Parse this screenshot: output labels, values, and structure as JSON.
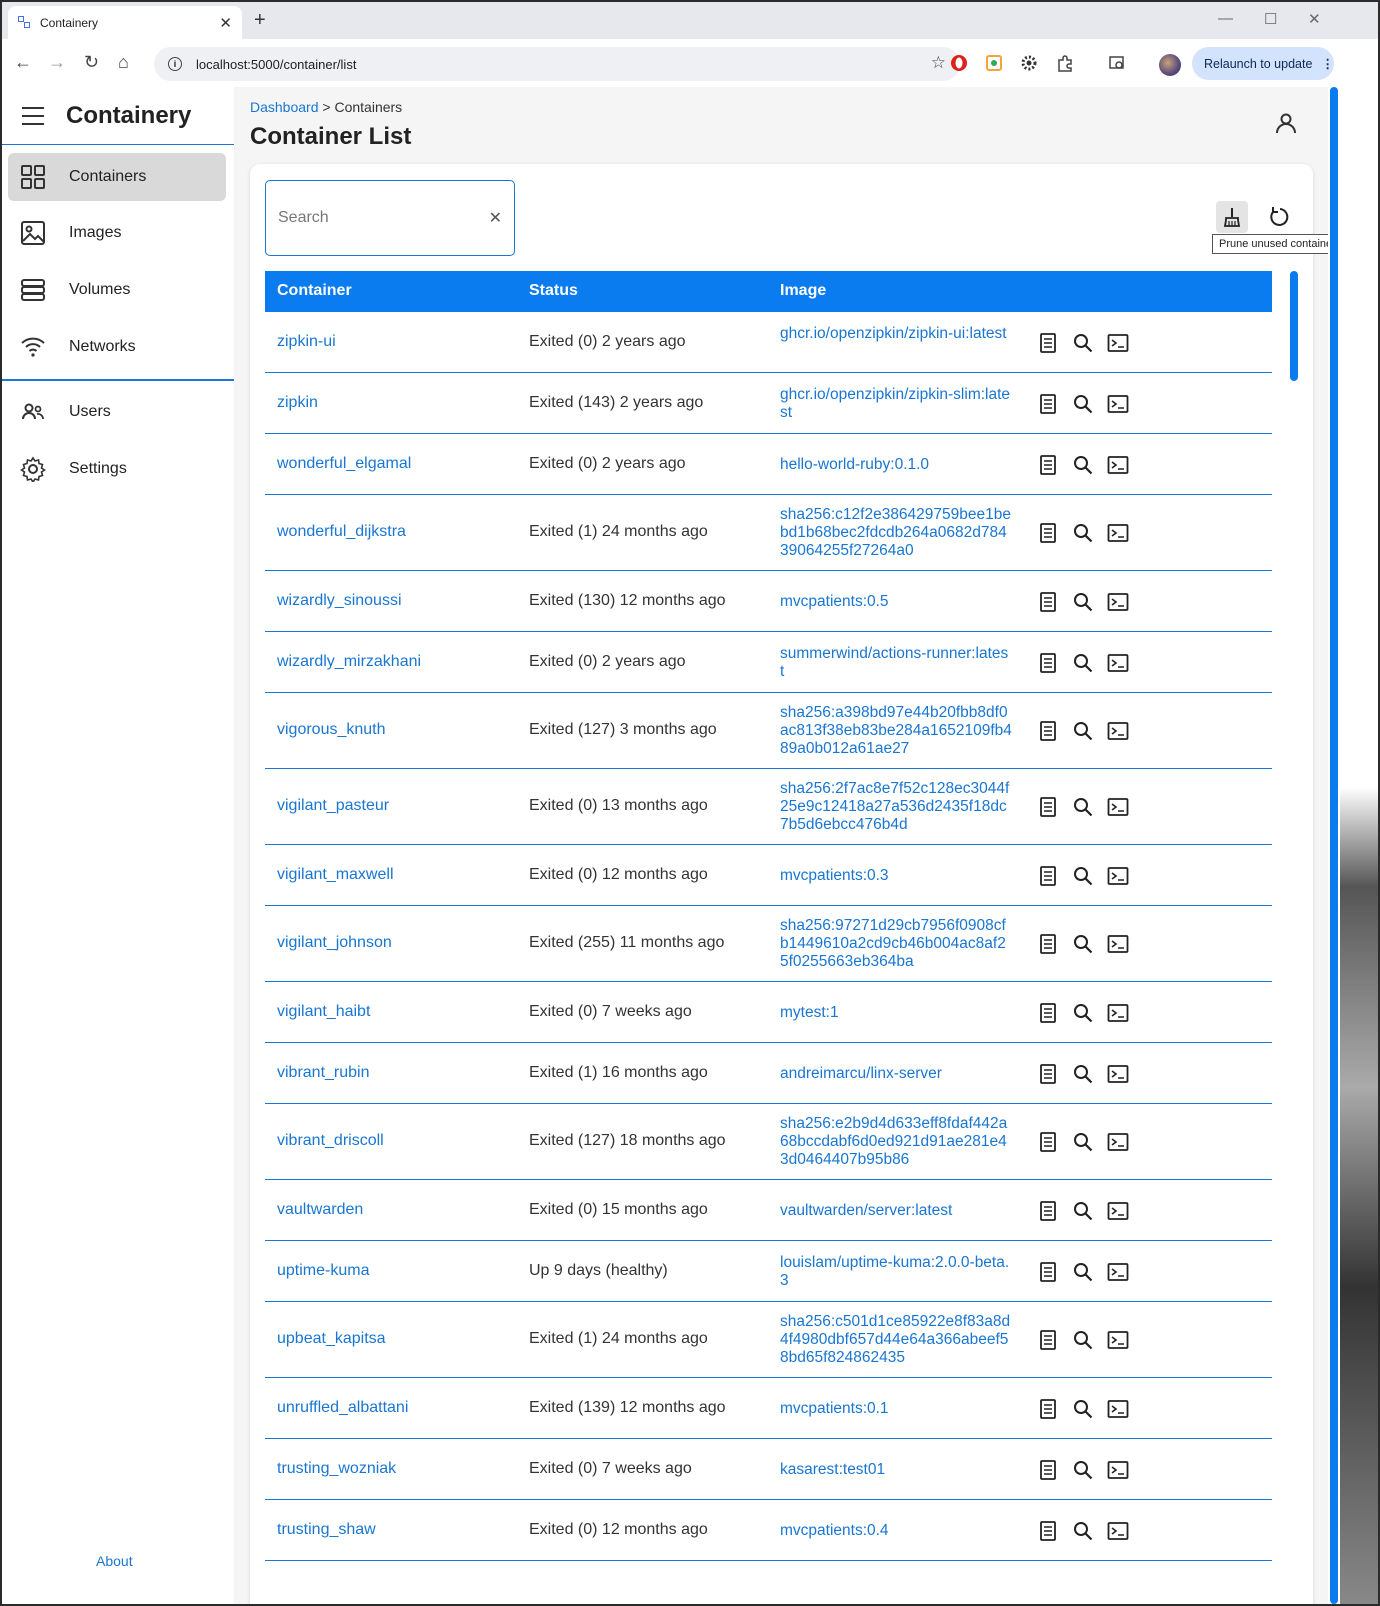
{
  "browser": {
    "tab_title": "Containery",
    "url": "localhost:5000/container/list",
    "relaunch_label": "Relaunch to update"
  },
  "app": {
    "brand": "Containery",
    "nav": [
      {
        "label": "Containers",
        "icon": "grid-icon",
        "active": true
      },
      {
        "label": "Images",
        "icon": "image-icon",
        "active": false
      },
      {
        "label": "Volumes",
        "icon": "database-icon",
        "active": false
      },
      {
        "label": "Networks",
        "icon": "wifi-icon",
        "active": false
      },
      {
        "label": "Users",
        "icon": "users-icon",
        "active": false
      },
      {
        "label": "Settings",
        "icon": "gear-icon",
        "active": false
      }
    ],
    "about_label": "About"
  },
  "breadcrumb": {
    "root": "Dashboard",
    "separator": ">",
    "current": "Containers"
  },
  "page_title": "Container List",
  "search": {
    "placeholder": "Search",
    "value": ""
  },
  "tooltip": "Prune unused containers",
  "table": {
    "headers": [
      "Container",
      "Status",
      "Image"
    ],
    "rows": [
      {
        "name": "zipkin-ui",
        "status": "Exited (0) 2 years ago",
        "image": "ghcr.io/openzipkin/zipkin-ui:latest"
      },
      {
        "name": "zipkin",
        "status": "Exited (143) 2 years ago",
        "image": "ghcr.io/openzipkin/zipkin-slim:latest"
      },
      {
        "name": "wonderful_elgamal",
        "status": "Exited (0) 2 years ago",
        "image": "hello-world-ruby:0.1.0"
      },
      {
        "name": "wonderful_dijkstra",
        "status": "Exited (1) 24 months ago",
        "image": "sha256:c12f2e386429759bee1bebd1b68bec2fdcdb264a0682d78439064255f27264a0"
      },
      {
        "name": "wizardly_sinoussi",
        "status": "Exited (130) 12 months ago",
        "image": "mvcpatients:0.5"
      },
      {
        "name": "wizardly_mirzakhani",
        "status": "Exited (0) 2 years ago",
        "image": "summerwind/actions-runner:latest"
      },
      {
        "name": "vigorous_knuth",
        "status": "Exited (127) 3 months ago",
        "image": "sha256:a398bd97e44b20fbb8df0ac813f38eb83be284a1652109fb489a0b012a61ae27"
      },
      {
        "name": "vigilant_pasteur",
        "status": "Exited (0) 13 months ago",
        "image": "sha256:2f7ac8e7f52c128ec3044f25e9c12418a27a536d2435f18dc7b5d6ebcc476b4d"
      },
      {
        "name": "vigilant_maxwell",
        "status": "Exited (0) 12 months ago",
        "image": "mvcpatients:0.3"
      },
      {
        "name": "vigilant_johnson",
        "status": "Exited (255) 11 months ago",
        "image": "sha256:97271d29cb7956f0908cfb1449610a2cd9cb46b004ac8af25f0255663eb364ba"
      },
      {
        "name": "vigilant_haibt",
        "status": "Exited (0) 7 weeks ago",
        "image": "mytest:1"
      },
      {
        "name": "vibrant_rubin",
        "status": "Exited (1) 16 months ago",
        "image": "andreimarcu/linx-server"
      },
      {
        "name": "vibrant_driscoll",
        "status": "Exited (127) 18 months ago",
        "image": "sha256:e2b9d4d633eff8fdaf442a68bccdabf6d0ed921d91ae281e43d0464407b95b86"
      },
      {
        "name": "vaultwarden",
        "status": "Exited (0) 15 months ago",
        "image": "vaultwarden/server:latest"
      },
      {
        "name": "uptime-kuma",
        "status": "Up 9 days (healthy)",
        "image": "louislam/uptime-kuma:2.0.0-beta.3"
      },
      {
        "name": "upbeat_kapitsa",
        "status": "Exited (1) 24 months ago",
        "image": "sha256:c501d1ce85922e8f83a8d4f4980dbf657d44e64a366abeef58bd65f824862435"
      },
      {
        "name": "unruffled_albattani",
        "status": "Exited (139) 12 months ago",
        "image": "mvcpatients:0.1"
      },
      {
        "name": "trusting_wozniak",
        "status": "Exited (0) 7 weeks ago",
        "image": "kasarest:test01"
      },
      {
        "name": "trusting_shaw",
        "status": "Exited (0) 12 months ago",
        "image": "mvcpatients:0.4"
      }
    ]
  },
  "colors": {
    "accent": "#1976d2",
    "header": "#0a7cf0"
  }
}
